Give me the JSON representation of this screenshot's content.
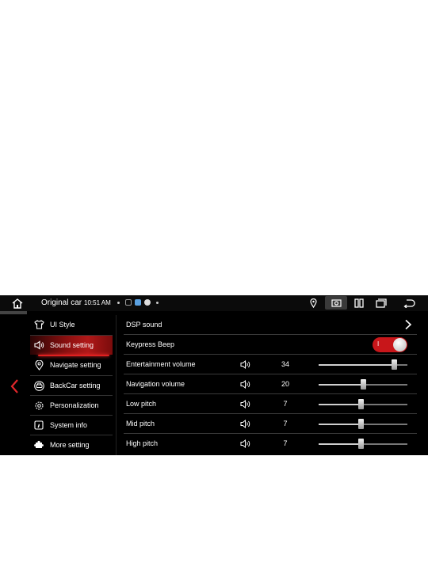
{
  "status_bar": {
    "title": "Original car",
    "time": "10:51 AM",
    "icons": [
      "home-icon",
      "notification-icon",
      "app-icon",
      "location-icon",
      "screenshot-icon",
      "split-screen-icon",
      "recent-apps-icon",
      "back-icon"
    ]
  },
  "menu": {
    "items": [
      {
        "label": "UI Style",
        "icon": "shirt-icon",
        "active": false
      },
      {
        "label": "Sound setting",
        "icon": "speaker-icon",
        "active": true
      },
      {
        "label": "Navigate setting",
        "icon": "location-pin-icon",
        "active": false
      },
      {
        "label": "BackCar setting",
        "icon": "car-icon",
        "active": false
      },
      {
        "label": "Personalization",
        "icon": "gear-icon",
        "active": false
      },
      {
        "label": "System info",
        "icon": "info-icon",
        "active": false
      },
      {
        "label": "More setting",
        "icon": "puzzle-icon",
        "active": false
      }
    ]
  },
  "settings": {
    "dsp": {
      "label": "DSP sound"
    },
    "keypress_beep": {
      "label": "Keypress Beep",
      "state_text": "I",
      "enabled": true
    },
    "sliders": [
      {
        "label": "Entertainment volume",
        "value": "34",
        "fraction": 0.85
      },
      {
        "label": "Navigation volume",
        "value": "20",
        "fraction": 0.5
      },
      {
        "label": "Low pitch",
        "value": "7",
        "fraction": 0.47
      },
      {
        "label": "Mid pitch",
        "value": "7",
        "fraction": 0.47
      },
      {
        "label": "High pitch",
        "value": "7",
        "fraction": 0.47
      }
    ]
  },
  "colors": {
    "accent": "#c8161a",
    "background": "#000000",
    "text": "#ffffff"
  }
}
